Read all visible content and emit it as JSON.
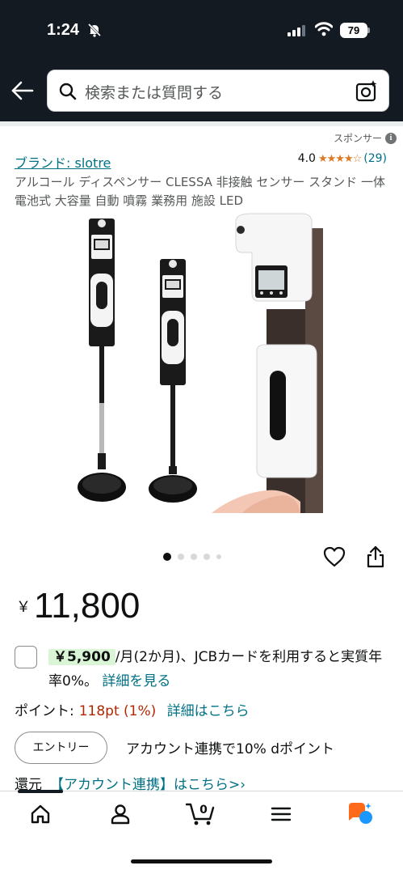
{
  "status_bar": {
    "time": "1:24",
    "battery": "79"
  },
  "search": {
    "placeholder": "検索または質問する"
  },
  "product": {
    "sponsored_label": "スポンサー",
    "brand_link": "ブランド: slotre",
    "rating_value": "4.0",
    "rating_stars": "★★★★☆",
    "rating_count": "(29)",
    "title": "アルコール ディスペンサー CLESSA 非接触 センサー スタンド 一体 電池式 大容量 自動 噴霧 業務用 施設 LED"
  },
  "carousel": {
    "total_images": 5,
    "active_index": 0
  },
  "price": {
    "currency_symbol": "￥",
    "value": "11,800"
  },
  "installment": {
    "badge": "￥5,900",
    "text": "/月(2か月)、JCBカードを利用すると実質年率0%。",
    "link": "詳細を見る"
  },
  "points": {
    "label": "ポイント:",
    "value": "118pt  (1%)",
    "link": "詳細はこちら"
  },
  "dpoint": {
    "entry_button": "エントリー",
    "text": "アカウント連携で10% dポイント",
    "return_label": "還元",
    "link": "【アカウント連携】はこちら>›"
  },
  "bottom_nav": {
    "items": [
      "home-icon",
      "account-icon",
      "cart-icon",
      "menu-icon",
      "rufus-icon"
    ],
    "cart_count": "0"
  },
  "colors": {
    "header_bg": "#131a22",
    "link": "#007185",
    "price_red": "#b12704",
    "star": "#de7921",
    "badge_green": "#d9f5d6",
    "rufus_orange": "#ff6a1a",
    "rufus_blue": "#1a98ff"
  }
}
